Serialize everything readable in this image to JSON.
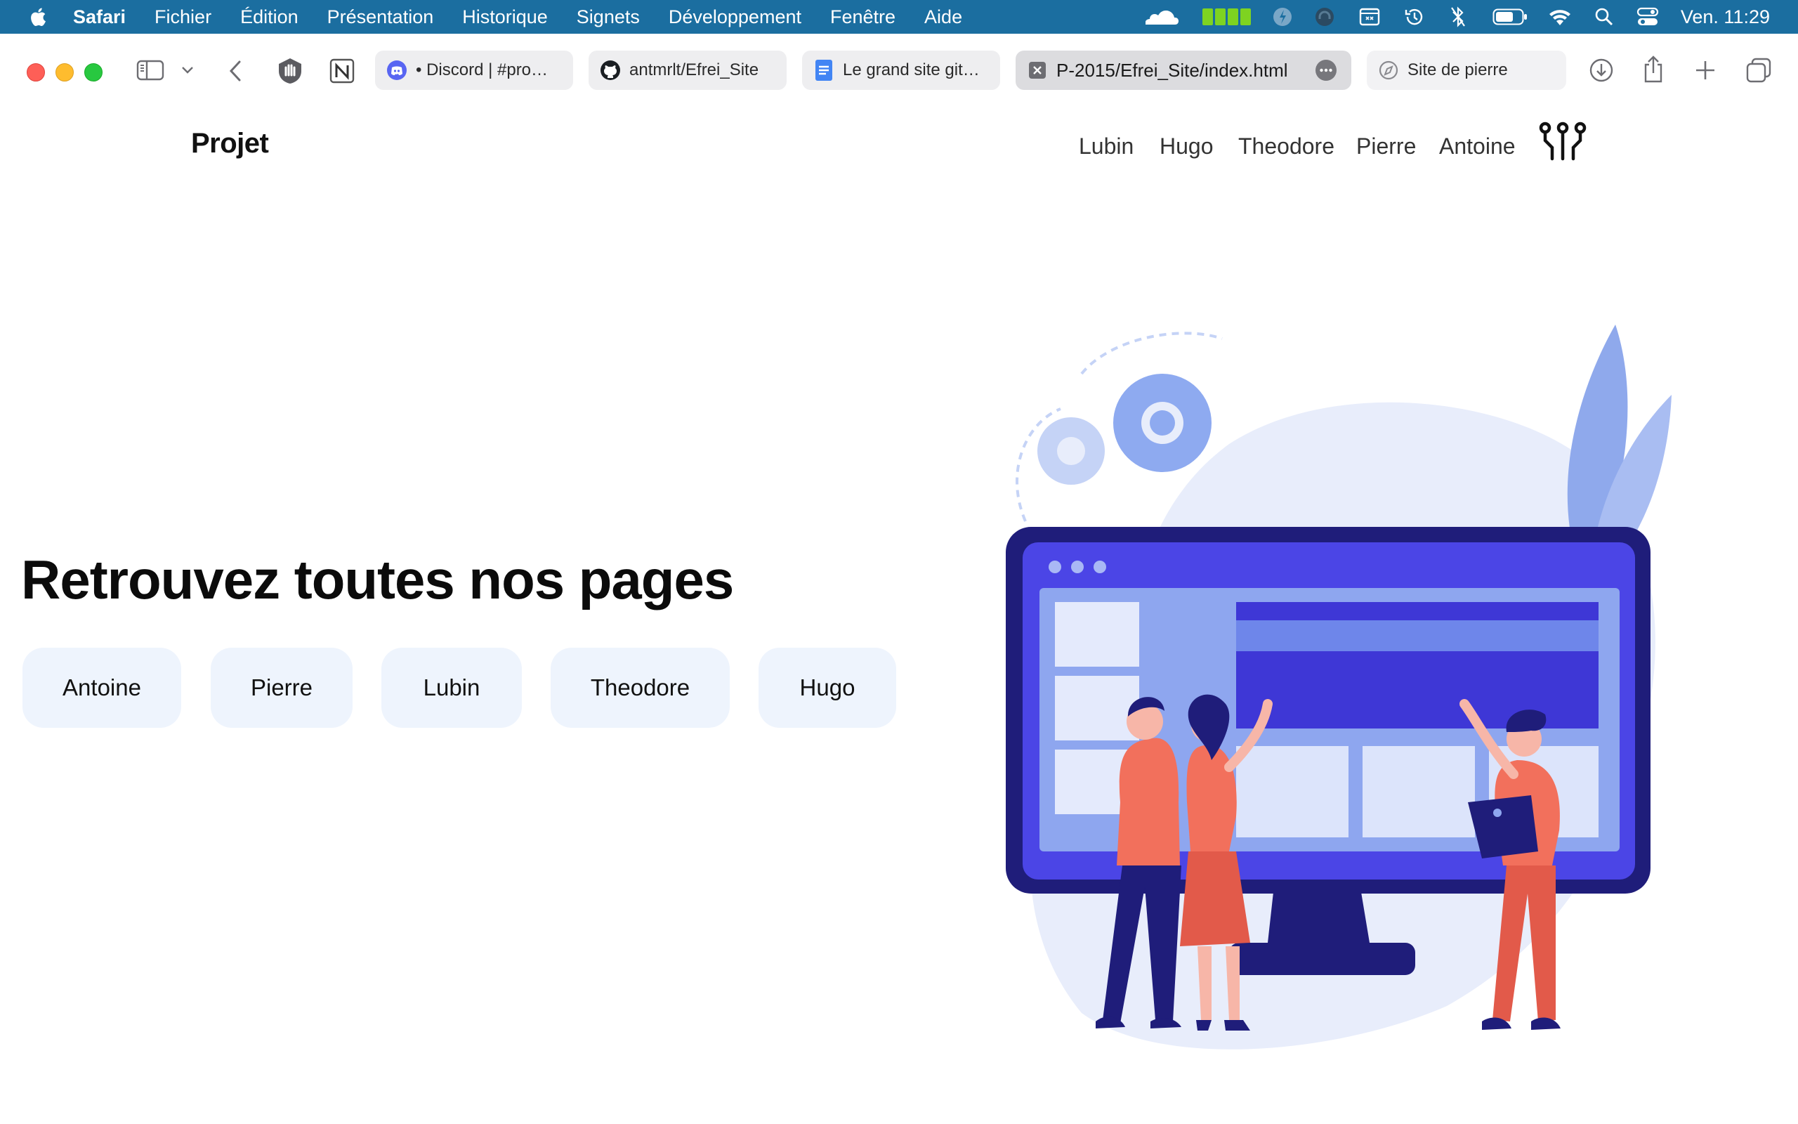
{
  "menubar": {
    "app_name": "Safari",
    "items": [
      "Fichier",
      "Édition",
      "Présentation",
      "Historique",
      "Signets",
      "Développement",
      "Fenêtre",
      "Aide"
    ],
    "clock": "Ven. 11:29",
    "status_icons": [
      "cloudflare-icon",
      "battery-bars-icon",
      "vpn-icon",
      "headphones-icon",
      "screen-icon",
      "time-machine-icon",
      "bluetooth-icon",
      "battery-icon",
      "wifi-icon",
      "spotlight-icon",
      "control-center-icon"
    ]
  },
  "tabs": [
    {
      "label": "• Discord | #pro…",
      "icon": "discord-icon"
    },
    {
      "label": "antmrlt/Efrei_Site",
      "icon": "github-icon"
    },
    {
      "label": "Le grand site git…",
      "icon": "docs-icon"
    },
    {
      "label": "P-2015/Efrei_Site/index.html",
      "icon": "close-tab-icon"
    },
    {
      "label": "Site de pierre",
      "icon": "compass-icon"
    }
  ],
  "page": {
    "brand": "Projet",
    "nav": [
      "Lubin",
      "Hugo",
      "Theodore",
      "Pierre",
      "Antoine"
    ],
    "headline": "Retrouvez toutes nos pages",
    "buttons": [
      "Antoine",
      "Pierre",
      "Lubin",
      "Theodore",
      "Hugo"
    ]
  },
  "colors": {
    "menubar": "#1b6ea0",
    "button_bg": "#eef4fd",
    "monitor": "#1f1d7a",
    "screen_accent": "#4b45e6",
    "people": "#f2705c"
  }
}
